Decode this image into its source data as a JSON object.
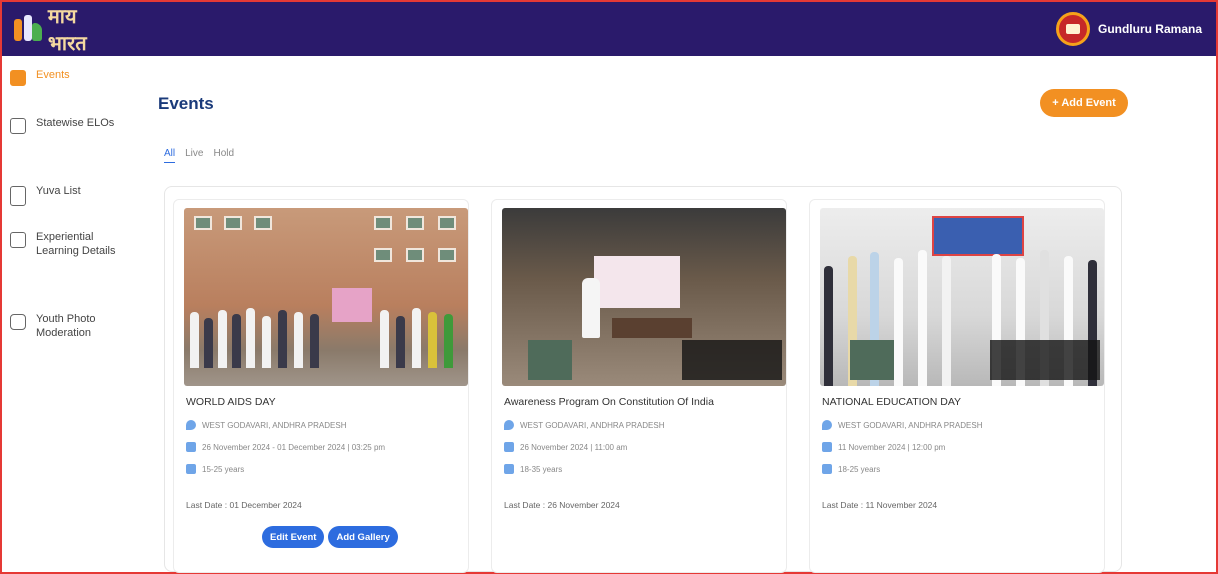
{
  "header": {
    "logo_text": "माय भारत",
    "user_name": "Gundluru Ramana"
  },
  "sidebar": {
    "items": [
      {
        "label": "Events",
        "icon": "events-icon",
        "active": true
      },
      {
        "label": "Statewise ELOs",
        "icon": "statewise-icon",
        "active": false
      },
      {
        "label": "Yuva List",
        "icon": "list-icon",
        "active": false
      },
      {
        "label": "Experiential Learning Details",
        "icon": "grid-icon",
        "active": false
      },
      {
        "label": "Youth Photo Moderation",
        "icon": "photo-icon",
        "active": false
      }
    ]
  },
  "main": {
    "title": "Events",
    "add_button": "+ Add Event",
    "tabs": [
      {
        "label": "All",
        "active": true
      },
      {
        "label": "Live",
        "active": false
      },
      {
        "label": "Hold",
        "active": false
      }
    ],
    "cards": [
      {
        "title": "WORLD AIDS DAY",
        "location": "WEST GODAVARI, ANDHRA PRADESH",
        "date": "26 November 2024 - 01 December 2024 | 03:25 pm",
        "age": "15-25 years",
        "last_date": "Last Date : 01 December 2024",
        "edit_label": "Edit Event",
        "gallery_label": "Add Gallery"
      },
      {
        "title": "Awareness Program On Constitution Of India",
        "location": "WEST GODAVARI, ANDHRA PRADESH",
        "date": "26 November 2024 | 11:00 am",
        "age": "18-35 years",
        "last_date": "Last Date : 26 November 2024"
      },
      {
        "title": "NATIONAL EDUCATION DAY",
        "location": "WEST GODAVARI, ANDHRA PRADESH",
        "date": "11 November 2024 | 12:00 pm",
        "age": "18-25 years",
        "last_date": "Last Date : 11 November 2024"
      }
    ]
  },
  "colors": {
    "header_bg": "#2a1a6b",
    "accent_orange": "#f29022",
    "primary_blue": "#2d6cdf",
    "title_blue": "#1a3a7a"
  }
}
